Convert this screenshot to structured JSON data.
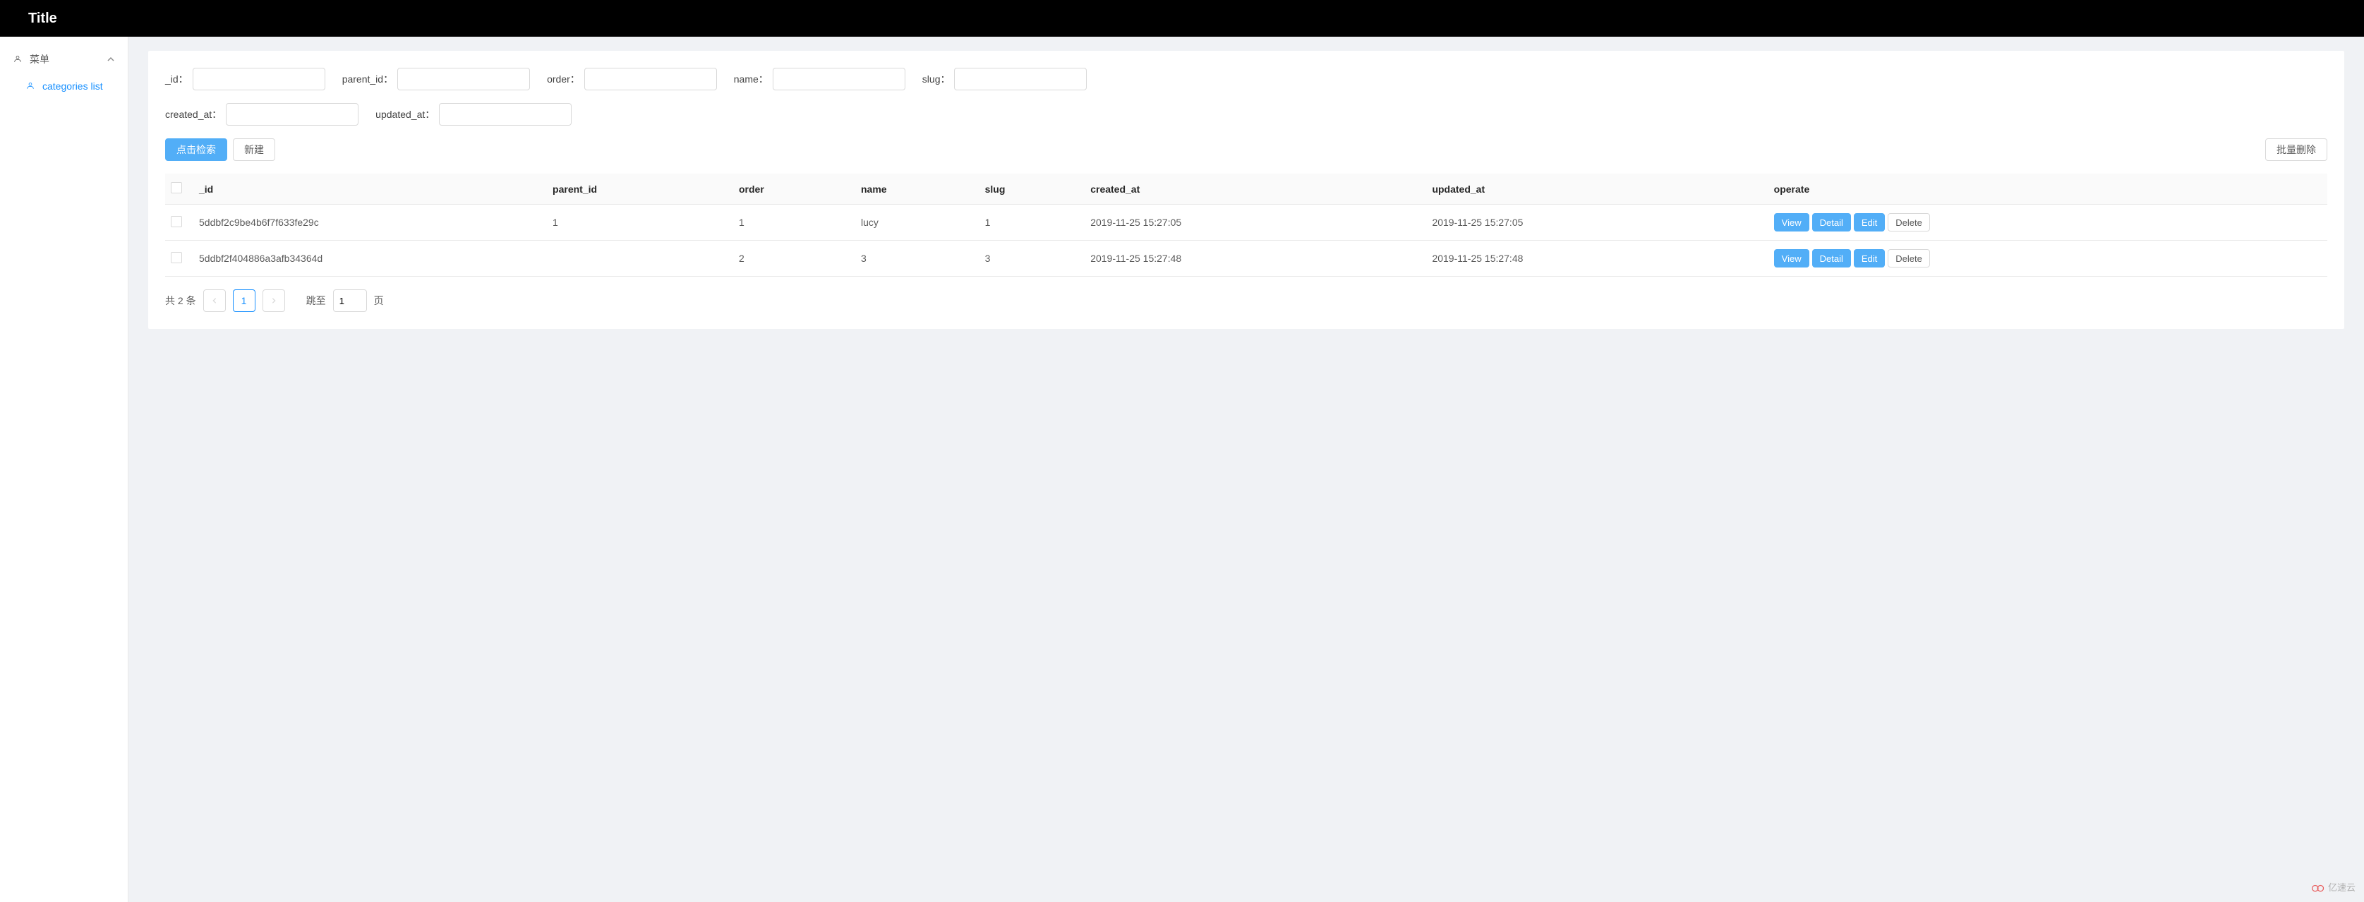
{
  "header": {
    "title": "Title"
  },
  "sidebar": {
    "menu_label": "菜单",
    "submenu_label": "categories list"
  },
  "filters": {
    "id_label": "_id：",
    "parent_id_label": "parent_id：",
    "order_label": "order：",
    "name_label": "name：",
    "slug_label": "slug：",
    "created_at_label": "created_at：",
    "updated_at_label": "updated_at："
  },
  "buttons": {
    "search": "点击检索",
    "create": "新建",
    "batch_delete": "批量删除",
    "view": "View",
    "detail": "Detail",
    "edit": "Edit",
    "delete": "Delete"
  },
  "table": {
    "columns": {
      "id": "_id",
      "parent_id": "parent_id",
      "order": "order",
      "name": "name",
      "slug": "slug",
      "created_at": "created_at",
      "updated_at": "updated_at",
      "operate": "operate"
    },
    "rows": [
      {
        "_id": "5ddbf2c9be4b6f7f633fe29c",
        "parent_id": "1",
        "order": "1",
        "name": "lucy",
        "slug": "1",
        "created_at": "2019-11-25 15:27:05",
        "updated_at": "2019-11-25 15:27:05"
      },
      {
        "_id": "5ddbf2f404886a3afb34364d",
        "parent_id": "",
        "order": "2",
        "name": "3",
        "slug": "3",
        "created_at": "2019-11-25 15:27:48",
        "updated_at": "2019-11-25 15:27:48"
      }
    ]
  },
  "pagination": {
    "total_text": "共 2 条",
    "current_page": "1",
    "jump_label": "跳至",
    "jump_value": "1",
    "page_suffix": "页"
  },
  "watermark": {
    "text": "亿速云"
  }
}
